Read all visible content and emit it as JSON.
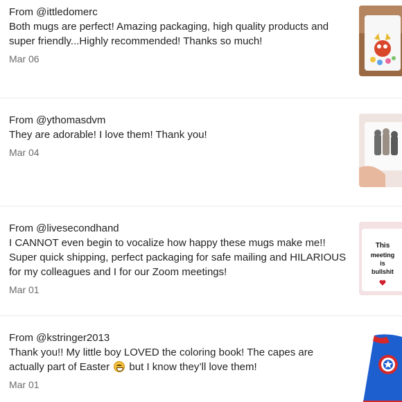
{
  "reviews": [
    {
      "from": "From @ittledomerc",
      "body": "Both mugs are perfect! Amazing packaging, high quality products and super friendly...Highly recommended! Thanks so much!",
      "date": "Mar 06",
      "thumbnail_icon": "mug-with-floral-character-icon"
    },
    {
      "from": "From @ythomasdvm",
      "body": "They are adorable! I love them! Thank you!",
      "date": "Mar 04",
      "thumbnail_icon": "mug-with-cats-icon"
    },
    {
      "from": "From @livesecondhand",
      "body": "I CANNOT even begin to vocalize how happy these mugs make me!! Super quick shipping, perfect packaging for safe mailing and HILARIOUS for my colleagues and I for our Zoom meetings!",
      "date": "Mar 01",
      "thumbnail_icon": "mug-with-text-icon",
      "thumbnail_text": [
        "This",
        "meeting",
        "is",
        "bullshit"
      ]
    },
    {
      "from": "From @kstringer2013",
      "body_part1": "Thank you!! My little boy LOVED the coloring book! The capes are actually part of Easter",
      "body_part2": "but I know they’ll love them!",
      "body_emoji": "grinning-face-emoji",
      "date": "Mar 01",
      "thumbnail_icon": "superhero-cape-icon"
    }
  ],
  "colors": {
    "text": "#222222",
    "date": "#6b6b6b",
    "divider": "#ececec"
  }
}
